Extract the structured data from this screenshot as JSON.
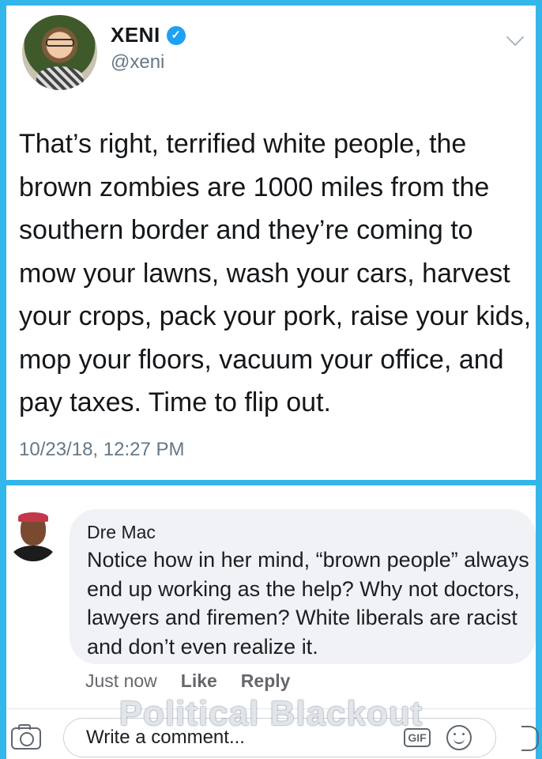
{
  "tweet": {
    "display_name": "XENI",
    "verified_mark": "✓",
    "handle": "@xeni",
    "text": "That’s right, terrified white people, the brown zombies are 1000 miles from the southern border and they’re coming to mow your lawns,  wash your cars, harvest your crops, pack your pork, raise your kids, mop your floors, vacuum your office, and pay taxes. Time to flip out.",
    "timestamp": "10/23/18, 12:27 PM"
  },
  "comment": {
    "author": "Dre Mac",
    "text": "Notice how in her mind, “brown people” always end up working as the help? Why not doctors, lawyers and firemen? White liberals are racist and don’t even realize it.",
    "time": "Just now",
    "like_label": "Like",
    "reply_label": "Reply"
  },
  "composer": {
    "placeholder": "Write a comment...",
    "gif_label": "GIF"
  },
  "watermark": "Political Blackout",
  "icons": {
    "verified": "verified-badge-icon",
    "chevron": "chevron-down-icon",
    "camera": "camera-icon",
    "gif": "gif-icon",
    "emoji": "emoji-icon",
    "sticker": "sticker-icon"
  },
  "colors": {
    "frame": "#33b6ea",
    "verified": "#1da1f2",
    "tweet_text": "#14171a",
    "muted": "#657786",
    "bubble": "#f0f2f5"
  }
}
